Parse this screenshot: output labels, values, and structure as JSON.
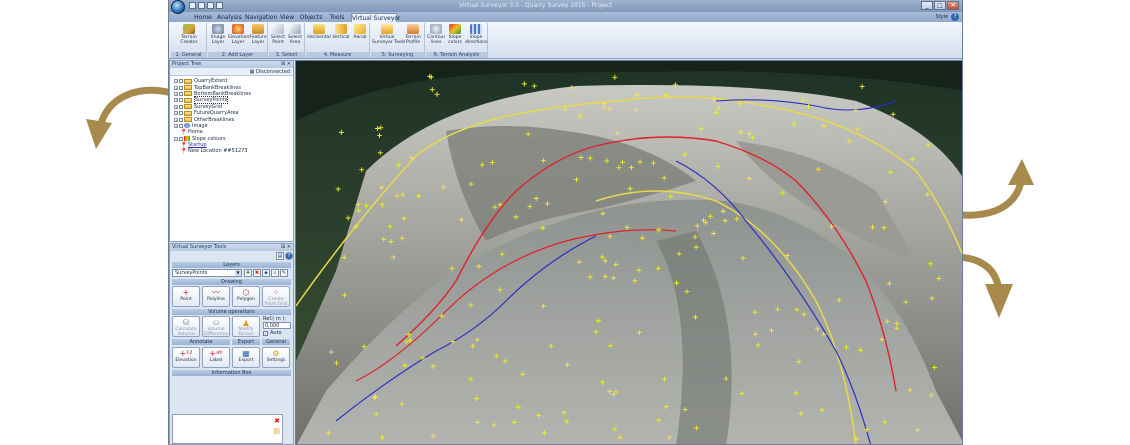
{
  "window": {
    "title": "Virtual Surveyor 3.0 - Quarry Survey 2015 - Project",
    "controls": [
      "_",
      "□",
      "✕"
    ]
  },
  "menu": {
    "tabs": [
      "Home",
      "Analysis",
      "Navigation",
      "View",
      "Objects",
      "Tools",
      "Virtual Surveyor"
    ],
    "active_tab": "Virtual Surveyor",
    "style_label": "Style",
    "help": "?"
  },
  "ribbon": {
    "groups": [
      {
        "label": "1. General",
        "buttons": [
          "Terrain\nCreator"
        ]
      },
      {
        "label": "2. Add Layer",
        "buttons": [
          "Image\nLayer",
          "Elevation\nLayer",
          "Feature\nLayer"
        ]
      },
      {
        "label": "3. Select",
        "buttons": [
          "Select\nPoint",
          "Select\nArea"
        ]
      },
      {
        "label": "4. Measure",
        "buttons": [
          "Horizontal",
          "Vertical",
          "Aerial"
        ]
      },
      {
        "label": "5. Surveying",
        "buttons": [
          "Virtual\nSurveyor Tools",
          "Terrain\nProfile"
        ]
      },
      {
        "label": "6. Terrain Analysis",
        "buttons": [
          "Contour\nlines",
          "Slope\ncolors",
          "Slope\ndirections"
        ]
      }
    ]
  },
  "project_tree": {
    "title": "Project Tree",
    "status": "Disconnected",
    "items": [
      {
        "label": "QuarryExtent",
        "kind": "folder"
      },
      {
        "label": "TopBankBreaklines",
        "kind": "folder"
      },
      {
        "label": "BottomBankBreaklines",
        "kind": "folder"
      },
      {
        "label": "SurveyPoints",
        "kind": "folder"
      },
      {
        "label": "SurveyGrid",
        "kind": "folder"
      },
      {
        "label": "FutureQuarryArea",
        "kind": "folder"
      },
      {
        "label": "OtherBreaklines",
        "kind": "folder"
      },
      {
        "label": "Image",
        "kind": "image"
      },
      {
        "label": "Home",
        "kind": "pin"
      },
      {
        "label": "Slope colours",
        "kind": "palette"
      },
      {
        "label": "Startup",
        "kind": "link"
      },
      {
        "label": "New Location ##51273",
        "kind": "pin"
      }
    ]
  },
  "vs_tools": {
    "title": "Virtual Surveyor Tools",
    "sections": {
      "layers": "Layers",
      "drawing": "Drawing",
      "volume": "Volume operations",
      "annotate": "Annotate",
      "export": "Export",
      "general": "General",
      "info": "Information Box"
    },
    "layer_value": "SurveyPoints",
    "drawing_buttons": [
      "Point",
      "Polyline",
      "Polygon",
      "Create\nPoint Grid"
    ],
    "volume_buttons": [
      "Calculate\nVolume",
      "Volume\nDifference",
      "Modify\nTerrain"
    ],
    "ref_label": "Ref.( m ):",
    "ref_value": "0,000",
    "auto_label": "Auto",
    "annotate_buttons": [
      "Elevation",
      "Label"
    ],
    "export_button": "Export",
    "settings_button": "Settings"
  },
  "colors": {
    "accent": "#2f66b0",
    "arrow": "#a88a4d",
    "survey_points": "#f3ec2a",
    "top_breaklines": "#e0202a",
    "bottom_breaklines": "#2b2fc2",
    "extent": "#e8d94a"
  }
}
